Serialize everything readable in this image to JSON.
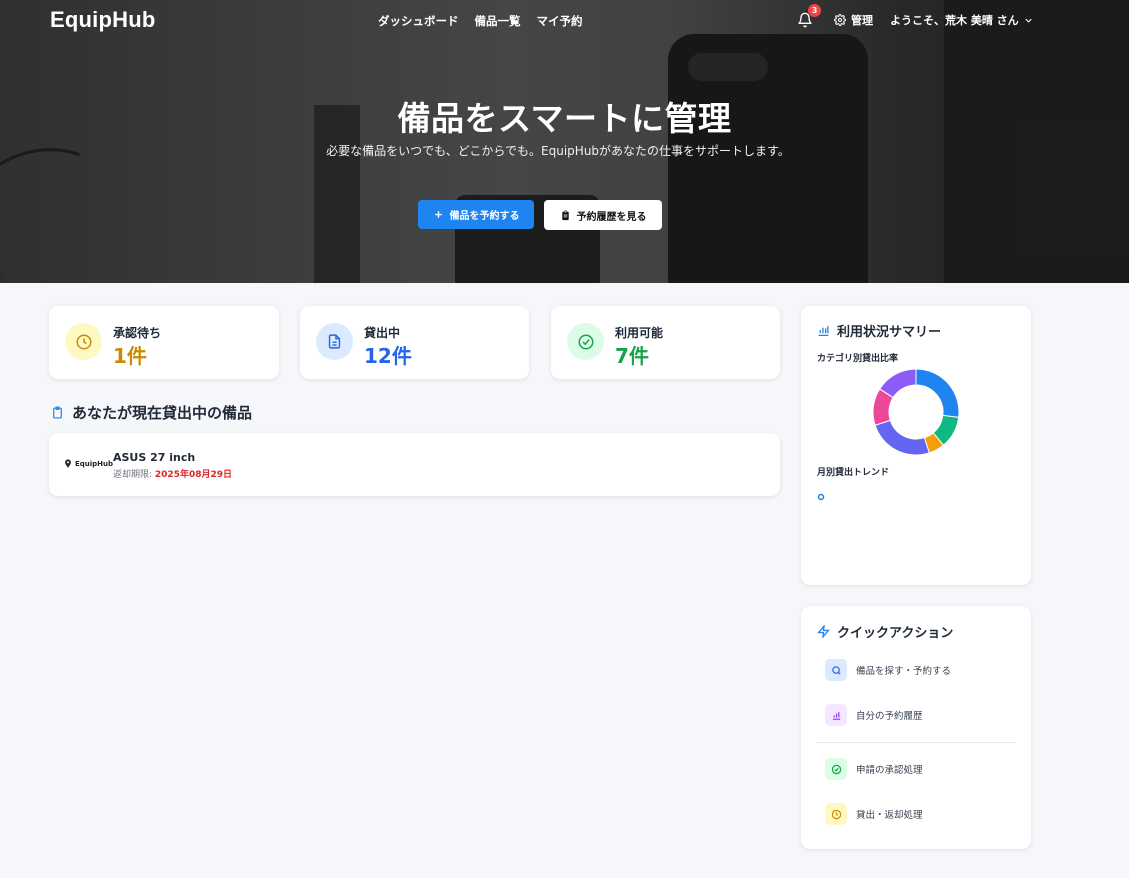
{
  "app": {
    "name": "EquipHub"
  },
  "nav": {
    "links": [
      "ダッシュボード",
      "備品一覧",
      "マイ予約"
    ],
    "notification_count": "3",
    "admin_label": "管理",
    "user_greeting": "ようこそ、荒木 美晴 さん"
  },
  "hero": {
    "title": "備品をスマートに管理",
    "subtitle": "必要な備品をいつでも、どこからでも。EquipHubがあなたの仕事をサポートします。",
    "primary_button": "備品を予約する",
    "secondary_button": "予約履歴を見る"
  },
  "stats": [
    {
      "label": "承認待ち",
      "value": "1件",
      "color": "#ca8a04",
      "bg": "#fef9c3"
    },
    {
      "label": "貸出中",
      "value": "12件",
      "color": "#2563eb",
      "bg": "#dbeafe"
    },
    {
      "label": "利用可能",
      "value": "7件",
      "color": "#16a34a",
      "bg": "#dcfce7"
    }
  ],
  "current_loans": {
    "title": "あなたが現在貸出中の備品",
    "items": [
      {
        "logo_text": "EquipHub",
        "name": "ASUS 27 inch",
        "due_label": "返却期限: ",
        "due_date": "2025年08月29日"
      }
    ]
  },
  "summary": {
    "title": "利用状況サマリー",
    "category_label": "カテゴリ別貸出比率",
    "trend_label": "月別貸出トレンド",
    "chart_data": {
      "type": "pie",
      "categories": [
        "",
        "",
        "",
        "",
        "",
        ""
      ],
      "values": [
        27,
        12,
        6,
        25,
        14,
        16
      ],
      "colors": [
        "#1d84f0",
        "#10b981",
        "#f59e0b",
        "#6366f1",
        "#ec4899",
        "#8b5cf6"
      ]
    }
  },
  "quick_actions": {
    "title": "クイックアクション",
    "items": [
      {
        "label": "備品を探す・予約する",
        "icon": "search-icon",
        "color": "#2563eb",
        "bg": "#dbeafe"
      },
      {
        "label": "自分の予約履歴",
        "icon": "bar-chart-icon",
        "color": "#9333ea",
        "bg": "#f3e8ff"
      },
      {
        "label": "申請の承認処理",
        "icon": "check-circle-icon",
        "color": "#16a34a",
        "bg": "#dcfce7"
      },
      {
        "label": "貸出・返却処理",
        "icon": "clock-icon",
        "color": "#ca8a04",
        "bg": "#fef9c3"
      }
    ]
  }
}
